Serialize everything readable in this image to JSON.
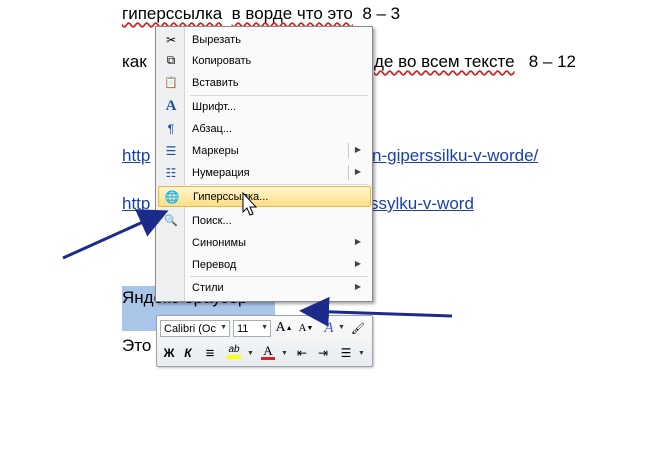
{
  "document": {
    "line1": {
      "text": "гиперссылка",
      "text2": "в ворде что это",
      "text3": "8 – 3"
    },
    "line2": {
      "prefix": "как",
      "suffix_a": "де во всем тексте",
      "suffix_b": "8 – 12"
    },
    "link1": {
      "start": "http",
      "end": "n-giperssilku-v-worde/"
    },
    "link2": {
      "start": "http",
      "end": "ssylku-v-word"
    },
    "selected_text": "Яндекс браузер",
    "line5_prefix": "Это"
  },
  "context_menu": {
    "items": [
      {
        "label": "Вырезать",
        "icon": "scissors-icon",
        "glyph": "✂"
      },
      {
        "label": "Копировать",
        "icon": "copy-icon",
        "glyph": "⧉"
      },
      {
        "label": "Вставить",
        "icon": "paste-icon",
        "glyph": "📋"
      },
      {
        "label": "Шрифт...",
        "icon": "font-icon",
        "glyph": "A"
      },
      {
        "label": "Абзац...",
        "icon": "paragraph-icon",
        "glyph": "¶"
      },
      {
        "label": "Маркеры",
        "icon": "bullets-icon",
        "glyph": "☰"
      },
      {
        "label": "Нумерация",
        "icon": "numbering-icon",
        "glyph": "☷"
      },
      {
        "label": "Гиперссылка...",
        "icon": "hyperlink-icon",
        "glyph": "🌐"
      },
      {
        "label": "Поиск...",
        "icon": "search-icon",
        "glyph": "🔍"
      },
      {
        "label": "Синонимы",
        "icon": "",
        "glyph": ""
      },
      {
        "label": "Перевод",
        "icon": "",
        "glyph": ""
      },
      {
        "label": "Стили",
        "icon": "",
        "glyph": ""
      }
    ],
    "submenu_arrow": "▶"
  },
  "mini_toolbar": {
    "font_name": "Calibri (Ос",
    "font_size": "11",
    "grow_font": "A",
    "shrink_font": "A",
    "styles": "A",
    "format_painter": "🖌",
    "bold": "Ж",
    "italic": "К",
    "center": "≡",
    "highlight": "ab",
    "font_color": "A",
    "indent_dec": "⇤",
    "indent_inc": "⇥",
    "bullets": "☰",
    "dropdown": "▼"
  },
  "colors": {
    "link": "#1a3fa8",
    "selection": "#a9c5e8",
    "highlight_item": "#ffdf86",
    "arrow": "#1c2a8a",
    "font_color_bar": "#e02020",
    "highlight_bar": "#ffff00"
  }
}
